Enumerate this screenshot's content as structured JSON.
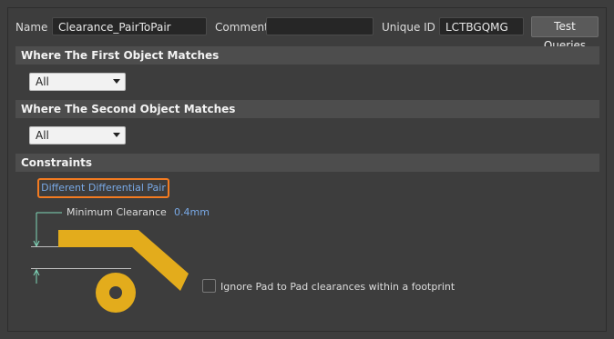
{
  "header": {
    "name_label": "Name",
    "name_value": "Clearance_PairToPair",
    "comment_label": "Comment",
    "comment_value": "",
    "uid_label": "Unique ID",
    "uid_value": "LCTBGQMG",
    "test_queries_label": "Test Queries"
  },
  "first_match": {
    "title": "Where The First Object Matches",
    "selected": "All"
  },
  "second_match": {
    "title": "Where The Second Object Matches",
    "selected": "All"
  },
  "constraints": {
    "title": "Constraints",
    "mode_link": "Different Differential Pair",
    "min_clearance_label": "Minimum Clearance",
    "min_clearance_value": "0.4mm",
    "ignore_pad_label": "Ignore Pad to Pad clearances within a footprint",
    "ignore_pad_checked": false
  },
  "colors": {
    "accent_orange": "#f37b21",
    "link_blue": "#79a9e6",
    "copper_yellow": "#e3ac1c",
    "guide_green": "#7fd6b8"
  }
}
